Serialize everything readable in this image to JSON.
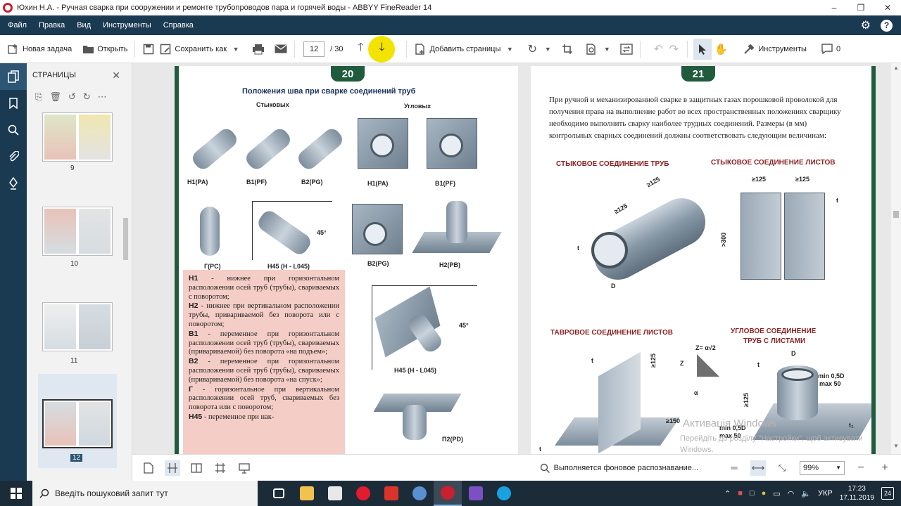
{
  "window": {
    "title": "Юхин Н.А. - Ручная сварка при сооружении и ремонте трубопроводов пара и горячей воды - ABBYY FineReader 14",
    "controls": [
      "–",
      "❐",
      "✕"
    ]
  },
  "menu": {
    "items": [
      "Файл",
      "Правка",
      "Вид",
      "Инструменты",
      "Справка"
    ]
  },
  "toolbar": {
    "new_task": "Новая задача",
    "open": "Открыть",
    "save_as": "Сохранить как",
    "page_current": "12",
    "page_total": "/ 30",
    "add_pages": "Добавить страницы",
    "tools": "Инструменты",
    "comments_count": "0"
  },
  "pages_panel": {
    "title": "СТРАНИЦЫ",
    "thumbnails": [
      {
        "label": "9"
      },
      {
        "label": "10"
      },
      {
        "label": "11"
      },
      {
        "label": "12",
        "selected": true
      }
    ]
  },
  "document": {
    "left_page": {
      "number": "20",
      "title": "Положения шва при сварке соединений труб",
      "col_butt": "Стыковых",
      "col_angle": "Угловых",
      "labels": [
        "H1(PA)",
        "B1(PF)",
        "B2(PG)",
        "H1(PA)",
        "B1(PF)",
        "Г(PC)",
        "H45 (H - L045)",
        "45°",
        "B2(PG)",
        "H2(PB)",
        "H45 (H - L045)",
        "45°",
        "П2(PD)"
      ],
      "legend": [
        {
          "code": "H1",
          "text": " - нижнее при горизонтальном расположении осей труб (трубы), свариваемых с поворотом;"
        },
        {
          "code": "H2",
          "text": " - нижнее при вертикальном расположении трубы, привариваемой без поворота или с поворотом;"
        },
        {
          "code": "B1",
          "text": " - переменное при горизонтальном расположении осей труб (трубы), свариваемых (привариваемой) без поворота «на подъем»;"
        },
        {
          "code": "B2",
          "text": " - переменное при горизонтальном расположении осей труб (трубы), свариваемых (привариваемой) без поворота «на спуск»;"
        },
        {
          "code": "Г",
          "text": " - горизонтальное при вертикальном расположении осей труб, свариваемых без поворота или с поворотом;"
        },
        {
          "code": "H45",
          "text": " - переменное при нак-"
        }
      ]
    },
    "right_page": {
      "number": "21",
      "intro": "При ручной и механизированной сварке в защитных газах порошковой проволокой для получения права на выполнение работ во всех пространственных положениях сварщику необходимо выполнить сварку наиболее трудных соединений. Размеры (в мм) контрольных сварных соединений должны соответствовать следующим величинам:",
      "headings": [
        "СТЫКОВОЕ СОЕДИНЕНИЕ ТРУБ",
        "СТЫКОВОЕ СОЕДИНЕНИЕ ЛИСТОВ",
        "ТАВРОВОЕ СОЕДИНЕНИЕ ЛИСТОВ",
        "УГЛОВОЕ СОЕДИНЕНИЕ",
        "ТРУБ С ЛИСТАМИ"
      ],
      "dims": [
        "≥125",
        "≥125",
        "t",
        "D",
        "≥125",
        "≥125",
        ">300",
        "t",
        "t",
        "≥125",
        "≥150",
        "Z",
        "Z= α√2",
        "α",
        "D",
        "min 0,5D",
        "max 50",
        "t",
        "≥125",
        "min 0,5D",
        "max 50",
        "t₁",
        "t"
      ]
    }
  },
  "watermark": {
    "line1": "Активація Windows",
    "line2": "Перейдіть до розділу \"Настройки\", щоб активувати Windows."
  },
  "statusbar": {
    "status": "Выполняется фоновое распознавание...",
    "zoom": "99%"
  },
  "taskbar": {
    "search_placeholder": "Введіть пошуковий запит тут",
    "lang": "УКР",
    "time": "17:23",
    "date": "17.11.2019",
    "notifications": "24"
  },
  "colors": {
    "menubar": "#1a3a52",
    "highlight": "#f3e300",
    "page_border": "#1f5b3c",
    "legend_bg": "#f4cdc6"
  }
}
